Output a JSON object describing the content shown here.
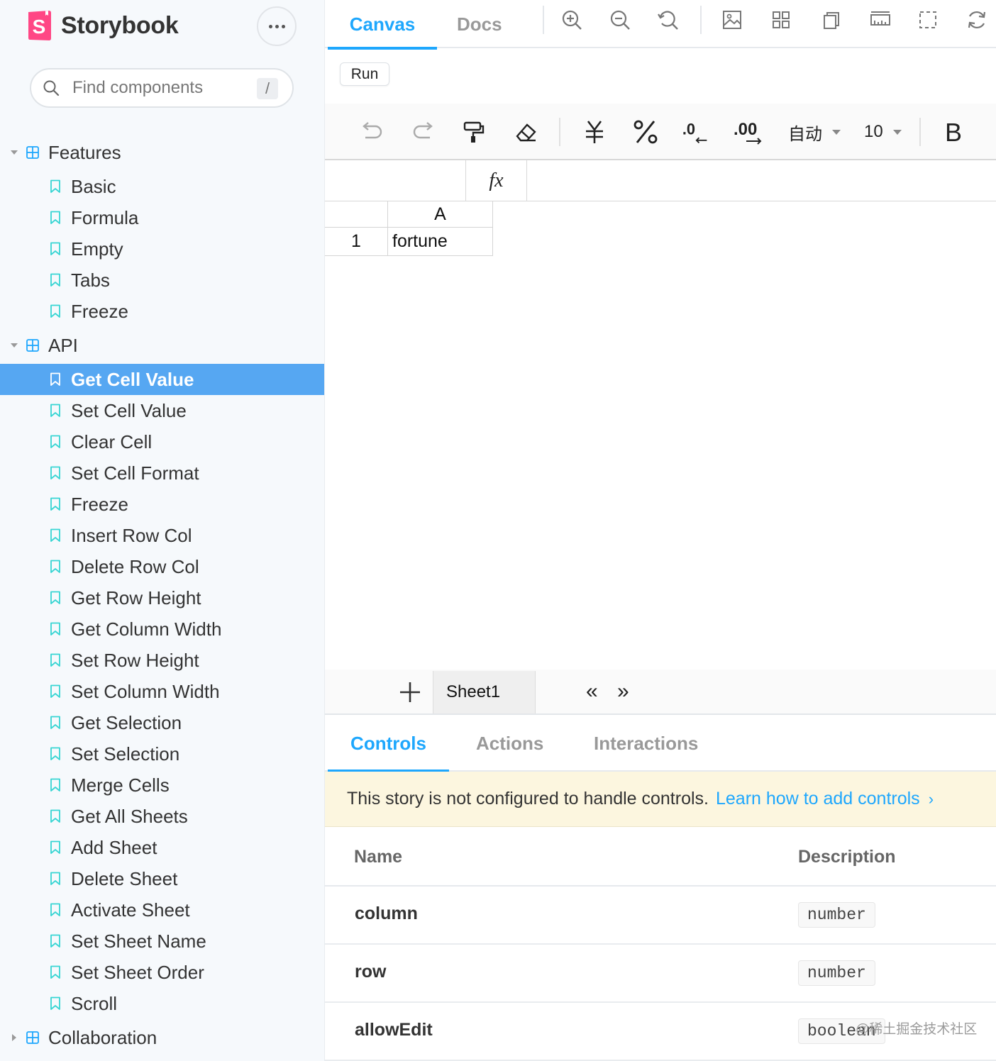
{
  "sidebar": {
    "brand": "Storybook",
    "logo_letter": "S",
    "search": {
      "placeholder": "Find components",
      "shortcut": "/"
    },
    "groups": [
      {
        "label": "Features",
        "expanded": true,
        "items": [
          "Basic",
          "Formula",
          "Empty",
          "Tabs",
          "Freeze"
        ]
      },
      {
        "label": "API",
        "expanded": true,
        "items": [
          "Get Cell Value",
          "Set Cell Value",
          "Clear Cell",
          "Set Cell Format",
          "Freeze",
          "Insert Row Col",
          "Delete Row Col",
          "Get Row Height",
          "Get Column Width",
          "Set Row Height",
          "Set Column Width",
          "Get Selection",
          "Set Selection",
          "Merge Cells",
          "Get All Sheets",
          "Add Sheet",
          "Delete Sheet",
          "Activate Sheet",
          "Set Sheet Name",
          "Set Sheet Order",
          "Scroll"
        ]
      },
      {
        "label": "Collaboration",
        "expanded": false,
        "items": []
      }
    ],
    "active_item": "Get Cell Value"
  },
  "toolbar": {
    "tabs": [
      "Canvas",
      "Docs"
    ],
    "active_tab": "Canvas",
    "icons": [
      "zoom-in-icon",
      "zoom-out-icon",
      "reset-zoom-icon",
      "background-icon",
      "grid-icon",
      "outline-icon",
      "measure-icon",
      "viewport-icon",
      "remount-icon"
    ]
  },
  "canvas": {
    "run_button": "Run",
    "sheet_toolbar": {
      "icons": [
        "undo-icon",
        "redo-icon",
        "format-painter-icon",
        "clear-format-icon",
        "currency-icon",
        "percent-icon",
        "decrease-decimal-icon",
        "increase-decimal-icon"
      ],
      "number_format": "自动",
      "font_size": "10",
      "bold": "B"
    },
    "formula_bar": {
      "fx": "fx",
      "value": ""
    },
    "grid": {
      "columns": [
        "A"
      ],
      "rows": [
        {
          "index": "1",
          "cells": [
            "fortune"
          ]
        }
      ]
    },
    "sheets": [
      "Sheet1"
    ],
    "active_sheet": "Sheet1",
    "nav": {
      "prev": "«",
      "next": "»"
    }
  },
  "addons": {
    "tabs": [
      "Controls",
      "Actions",
      "Interactions"
    ],
    "active_tab": "Controls",
    "notice": {
      "text": "This story is not configured to handle controls.",
      "link": "Learn how to add controls",
      "chevron": "›"
    },
    "table": {
      "headers": [
        "Name",
        "Description"
      ],
      "rows": [
        {
          "name": "column",
          "type": "number"
        },
        {
          "name": "row",
          "type": "number"
        },
        {
          "name": "allowEdit",
          "type": "boolean"
        }
      ]
    }
  },
  "watermark": "@稀土掘金技术社区",
  "colors": {
    "accent": "#1ea7fd",
    "selected": "#56a7f2",
    "brand": "#ff4785",
    "story_icon": "#37d5d3",
    "group_icon": "#1ea7fd"
  }
}
